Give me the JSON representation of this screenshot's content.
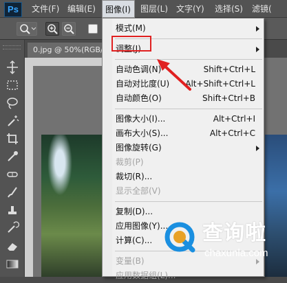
{
  "app": {
    "logo": "Ps"
  },
  "menubar": {
    "items": [
      "文件(F)",
      "编辑(E)",
      "图像(I)",
      "图层(L)",
      "文字(Y)",
      "选择(S)",
      "滤镜("
    ],
    "active_index": 2
  },
  "document_tab": {
    "title": "0.jpg @ 50%(RGB/"
  },
  "image_menu": {
    "groups": [
      [
        {
          "label": "模式(M)",
          "shortcut": "",
          "submenu": true,
          "disabled": false
        }
      ],
      [
        {
          "label": "调整(J)",
          "shortcut": "",
          "submenu": true,
          "disabled": false
        }
      ],
      [
        {
          "label": "自动色调(N)",
          "shortcut": "Shift+Ctrl+L",
          "submenu": false,
          "disabled": false
        },
        {
          "label": "自动对比度(U)",
          "shortcut": "Alt+Shift+Ctrl+L",
          "submenu": false,
          "disabled": false
        },
        {
          "label": "自动颜色(O)",
          "shortcut": "Shift+Ctrl+B",
          "submenu": false,
          "disabled": false
        }
      ],
      [
        {
          "label": "图像大小(I)...",
          "shortcut": "Alt+Ctrl+I",
          "submenu": false,
          "disabled": false
        },
        {
          "label": "画布大小(S)...",
          "shortcut": "Alt+Ctrl+C",
          "submenu": false,
          "disabled": false
        },
        {
          "label": "图像旋转(G)",
          "shortcut": "",
          "submenu": true,
          "disabled": false
        },
        {
          "label": "裁剪(P)",
          "shortcut": "",
          "submenu": false,
          "disabled": true
        },
        {
          "label": "裁切(R)...",
          "shortcut": "",
          "submenu": false,
          "disabled": false
        },
        {
          "label": "显示全部(V)",
          "shortcut": "",
          "submenu": false,
          "disabled": true
        }
      ],
      [
        {
          "label": "复制(D)...",
          "shortcut": "",
          "submenu": false,
          "disabled": false
        },
        {
          "label": "应用图像(Y)...",
          "shortcut": "",
          "submenu": false,
          "disabled": false
        },
        {
          "label": "计算(C)...",
          "shortcut": "",
          "submenu": false,
          "disabled": false
        }
      ],
      [
        {
          "label": "变量(B)",
          "shortcut": "",
          "submenu": true,
          "disabled": true
        },
        {
          "label": "应用数据组(L)...",
          "shortcut": "",
          "submenu": false,
          "disabled": true
        }
      ]
    ]
  },
  "annotation": {
    "color": "#e02020"
  },
  "watermark": {
    "text": "查询啦",
    "url": "chaxunla.com",
    "color": "#1a8fe0"
  },
  "icons": [
    "zoom-tool-icon",
    "zoom-in-icon",
    "zoom-out-icon",
    "move-tool-icon",
    "marquee-tool-icon",
    "lasso-tool-icon",
    "magic-wand-icon",
    "crop-tool-icon",
    "eyedropper-icon",
    "healing-brush-icon",
    "brush-tool-icon",
    "clone-stamp-icon",
    "history-brush-icon",
    "eraser-icon",
    "gradient-tool-icon"
  ]
}
